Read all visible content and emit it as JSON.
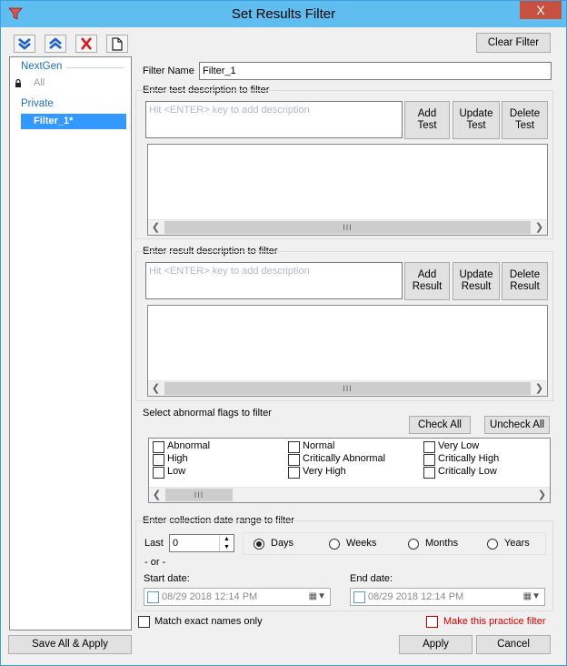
{
  "window": {
    "title": "Set Results Filter",
    "close_glyph": "X"
  },
  "toolbar": {
    "icons": [
      "move-down-icon",
      "move-up-icon",
      "delete-icon",
      "new-document-icon"
    ],
    "clear_filter": "Clear Filter"
  },
  "tree": {
    "group1": "NextGen",
    "group1_item": "All",
    "group2": "Private",
    "group2_item": "Filter_1*"
  },
  "filter_name": {
    "label": "Filter Name",
    "value": "Filter_1"
  },
  "test_section": {
    "label": "Enter test description to filter",
    "placeholder": "Hit <ENTER> key to add description",
    "add": [
      "Add",
      "Test"
    ],
    "update": [
      "Update",
      "Test"
    ],
    "delete": [
      "Delete",
      "Test"
    ]
  },
  "result_section": {
    "label": "Enter result description to filter",
    "placeholder": "Hit <ENTER> key to add description",
    "add": [
      "Add",
      "Result"
    ],
    "update": [
      "Update",
      "Result"
    ],
    "delete": [
      "Delete",
      "Result"
    ]
  },
  "flags_section": {
    "label": "Select abnormal flags to filter",
    "check_all": "Check All",
    "uncheck_all": "Uncheck All",
    "col1": [
      "Abnormal",
      "High",
      "Low"
    ],
    "col2": [
      "Normal",
      "Critically Abnormal",
      "Very High"
    ],
    "col3": [
      "Very Low",
      "Critically High",
      "Critically Low"
    ]
  },
  "date_section": {
    "label": "Enter collection date range to filter",
    "last_label": "Last",
    "last_value": "0",
    "units": [
      "Days",
      "Weeks",
      "Months",
      "Years"
    ],
    "selected_unit": "Days",
    "or_label": "- or -",
    "start_label": "Start date:",
    "start_value": "08/29 2018 12:14 PM",
    "end_label": "End date:",
    "end_value": "08/29 2018 12:14 PM"
  },
  "footer": {
    "match_exact": "Match exact names only",
    "practice_filter": "Make this practice filter",
    "save_all": "Save All & Apply",
    "apply": "Apply",
    "cancel": "Cancel"
  },
  "colors": {
    "titlebar": "#5fbdf0",
    "selection": "#3399ff",
    "tree_group": "#1f6fb5",
    "practice_filter": "#d40000"
  },
  "scroll_grip": "III"
}
